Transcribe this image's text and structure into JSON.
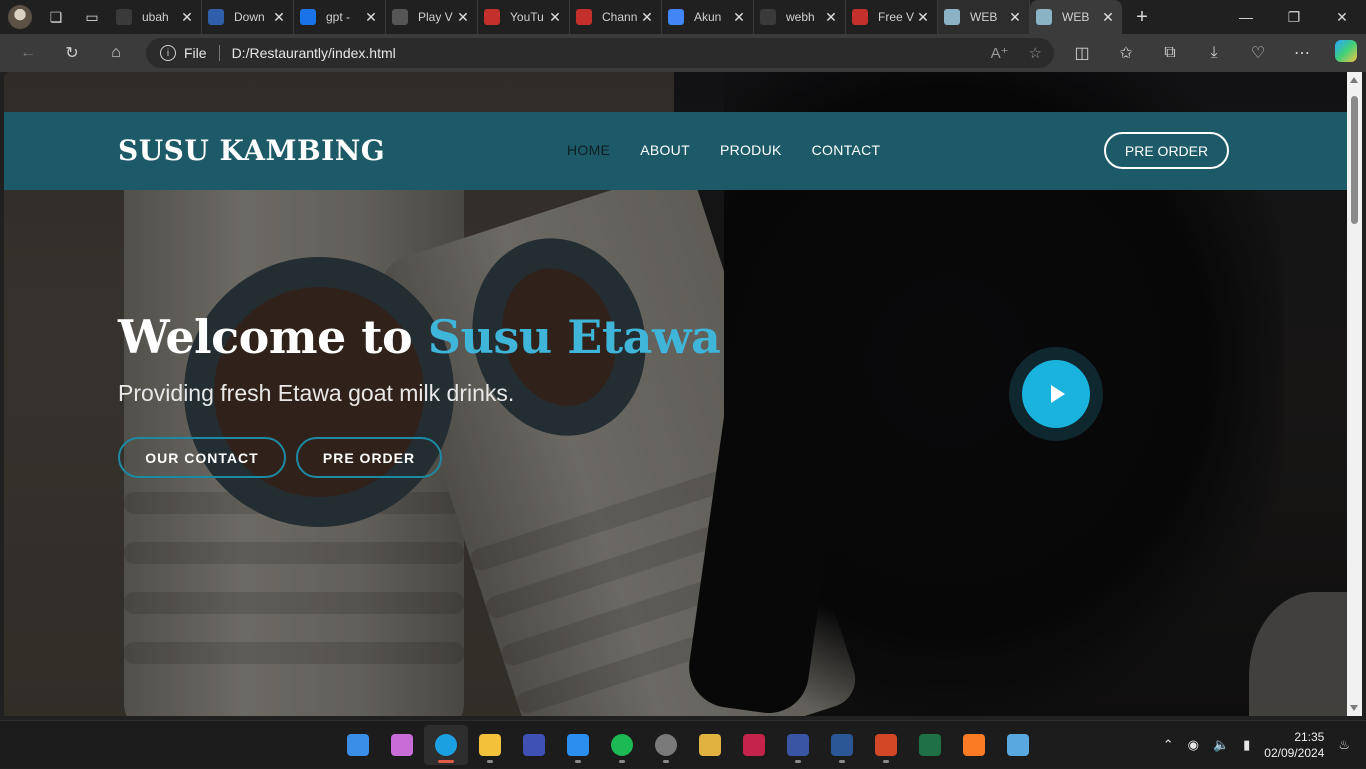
{
  "browser": {
    "tabs": [
      {
        "title": "ubah",
        "favicon": "search-icon",
        "color": "#3a3a3a"
      },
      {
        "title": "Down",
        "favicon": "number-2-icon",
        "color": "#2f5fa8"
      },
      {
        "title": "gpt - ",
        "favicon": "bing-icon",
        "color": "#1a73e8"
      },
      {
        "title": "Play V",
        "favicon": "chatgpt-icon",
        "color": "#555555"
      },
      {
        "title": "YouTu",
        "favicon": "youtube-icon",
        "color": "#c4302b"
      },
      {
        "title": "Chann",
        "favicon": "youtube-icon",
        "color": "#c4302b"
      },
      {
        "title": "Akun",
        "favicon": "google-icon",
        "color": "#4285f4"
      },
      {
        "title": "webh",
        "favicon": "search-icon",
        "color": "#3a3a3a"
      },
      {
        "title": "Free V",
        "favicon": "code-icon",
        "color": "#c4302b"
      },
      {
        "title": "WEB",
        "favicon": "globe-icon",
        "color": "#8ab4c6"
      },
      {
        "title": "WEB",
        "favicon": "globe-icon",
        "color": "#8ab4c6"
      }
    ],
    "address": {
      "label": "File",
      "url": "D:/Restaurantly/index.html"
    }
  },
  "site": {
    "brand": "SUSU KAMBING",
    "nav": [
      "HOME",
      "ABOUT",
      "PRODUK",
      "CONTACT"
    ],
    "cta_top": "PRE ORDER",
    "hero": {
      "title_prefix": "Welcome to ",
      "title_accent": "Susu Etawa",
      "subtitle": "Providing fresh Etawa goat milk drinks.",
      "btn_contact": "OUR CONTACT",
      "btn_order": "PRE ORDER"
    },
    "colors": {
      "navbar": "#1d5a68",
      "accent": "#3fb5d9",
      "play_button": "#19b3de"
    }
  },
  "taskbar": {
    "apps": [
      {
        "name": "start-icon",
        "color": "#3a8ee6"
      },
      {
        "name": "copilot-icon",
        "color": "#c86dd7"
      },
      {
        "name": "edge-icon",
        "color": "#1ba1e2"
      },
      {
        "name": "file-explorer-icon",
        "color": "#f3c13a"
      },
      {
        "name": "app-m-icon",
        "color": "#3f51b5"
      },
      {
        "name": "vscode-icon",
        "color": "#2b8ff0"
      },
      {
        "name": "spotify-icon",
        "color": "#1db954"
      },
      {
        "name": "media-player-icon",
        "color": "#7a7a7a"
      },
      {
        "name": "paint-tool-icon",
        "color": "#e0b341"
      },
      {
        "name": "castle-app-icon",
        "color": "#c4244b"
      },
      {
        "name": "visio-icon",
        "color": "#3955a3"
      },
      {
        "name": "word-icon",
        "color": "#2b5797"
      },
      {
        "name": "powerpoint-icon",
        "color": "#d24726"
      },
      {
        "name": "excel-icon",
        "color": "#1e7145"
      },
      {
        "name": "xampp-icon",
        "color": "#fb7a24"
      },
      {
        "name": "notepad-icon",
        "color": "#5aa8e0"
      }
    ],
    "time": "21:35",
    "date": "02/09/2024"
  }
}
